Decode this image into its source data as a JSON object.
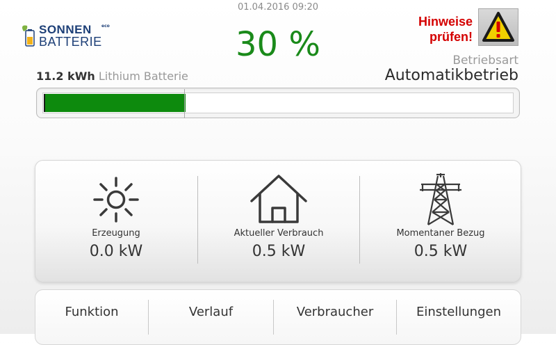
{
  "header": {
    "datetime": "01.04.2016 09:20",
    "logo_line1": "SONNEN",
    "logo_line2": "BATTERIE",
    "logo_sup": "eco",
    "percent": "30 %",
    "warning_line1": "Hinweise",
    "warning_line2": "prüfen!",
    "warning_icon": "warning-triangle-icon",
    "mode_label": "Betriebsart",
    "mode_value": "Automatikbetrieb"
  },
  "battery": {
    "capacity_value": "11.2 kWh",
    "capacity_type": "Lithium Batterie",
    "charge_fraction": 0.3,
    "fill_color": "#0d8a0d"
  },
  "stats": [
    {
      "label": "Erzeugung",
      "value": "0.0 kW",
      "icon": "sun-icon"
    },
    {
      "label": "Aktueller Verbrauch",
      "value": "0.5 kW",
      "icon": "house-icon"
    },
    {
      "label": "Momentaner Bezug",
      "value": "0.5 kW",
      "icon": "power-pylon-icon"
    }
  ],
  "nav": [
    {
      "label": "Funktion"
    },
    {
      "label": "Verlauf"
    },
    {
      "label": "Verbraucher"
    },
    {
      "label": "Einstellungen"
    }
  ],
  "colors": {
    "accent_green": "#1a8a1a",
    "warning_red": "#d40000",
    "brand_blue": "#1d3f77"
  }
}
